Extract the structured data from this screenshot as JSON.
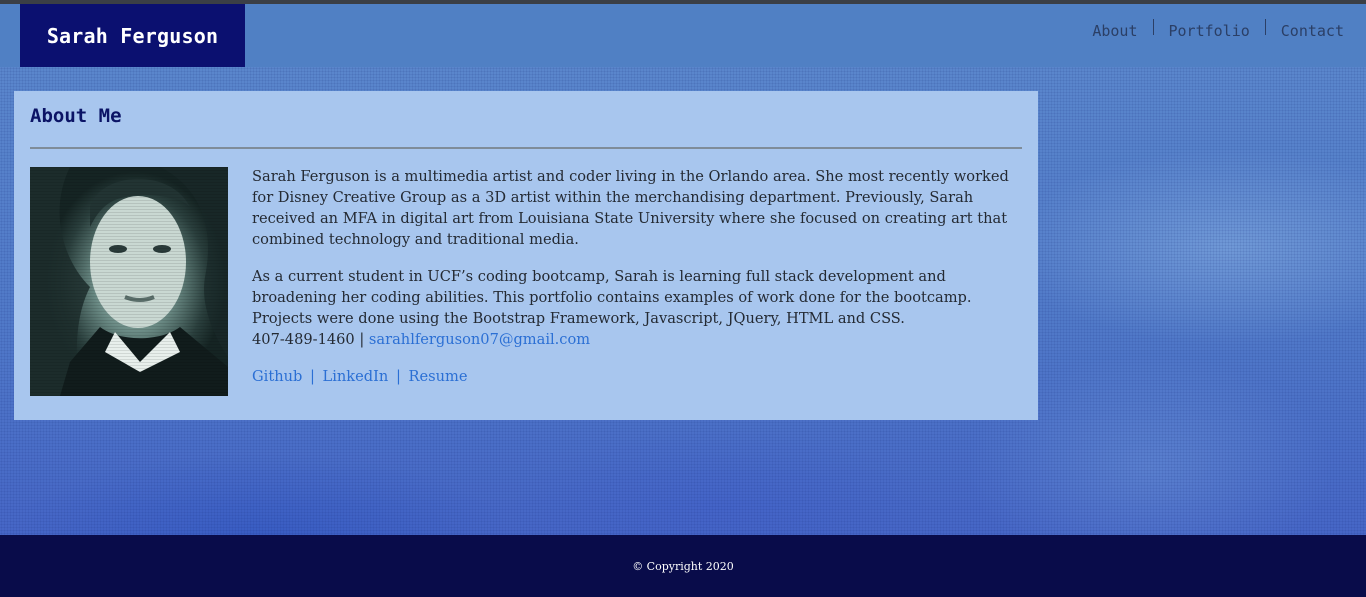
{
  "header": {
    "brand": "Sarah Ferguson",
    "nav": [
      {
        "label": "About"
      },
      {
        "label": "Portfolio"
      },
      {
        "label": "Contact"
      }
    ]
  },
  "about": {
    "heading": "About Me",
    "photo": {
      "icon": "profile-photo"
    },
    "paragraph1": "Sarah Ferguson is a multimedia artist and coder living in the Orlando area. She most recently worked for Disney Creative Group as a 3D artist within the merchandising department. Previously, Sarah received an MFA in digital art from Louisiana State University where she focused on creating art that combined technology and traditional media.",
    "paragraph2": "As a current student in UCF’s coding bootcamp, Sarah is learning full stack development and broadening her coding abilities. This portfolio contains examples of work done for the bootcamp. Projects were done using the Bootstrap Framework, Javascript, JQuery, HTML and CSS.",
    "phone": "407-489-1460",
    "phone_separator": " | ",
    "email": "sarahlferguson07@gmail.com",
    "links": [
      {
        "label": "Github"
      },
      {
        "label": "LinkedIn"
      },
      {
        "label": "Resume"
      }
    ],
    "link_separator": "|"
  },
  "footer": {
    "copyright": "© Copyright 2020"
  },
  "colors": {
    "navbar": "#5080c4",
    "brand_bg": "#0b1070",
    "card_bg": "#a8c6ee",
    "link": "#2b6fd4",
    "footer_bg": "#090c4a"
  }
}
